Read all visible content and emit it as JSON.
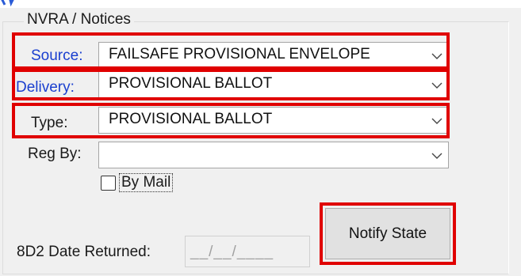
{
  "group": {
    "title": "NVRA / Notices"
  },
  "source": {
    "label": "Source:",
    "value": "FAILSAFE PROVISIONAL ENVELOPE"
  },
  "delivery": {
    "label": "Delivery:",
    "value": "PROVISIONAL BALLOT"
  },
  "type": {
    "label": "Type:",
    "value": "PROVISIONAL BALLOT"
  },
  "reg_by": {
    "label": "Reg By:",
    "value": ""
  },
  "by_mail": {
    "label": "By Mail",
    "checked": false
  },
  "date_returned": {
    "label": "8D2 Date Returned:",
    "value": "__/__/____"
  },
  "notify_button": {
    "label": "Notify State"
  },
  "colors": {
    "highlight": "#e00000",
    "label_blue": "#1a3fcf",
    "panel_bg": "#f0f0f0"
  },
  "icons": {
    "dropdown": "chevron-down-icon"
  }
}
